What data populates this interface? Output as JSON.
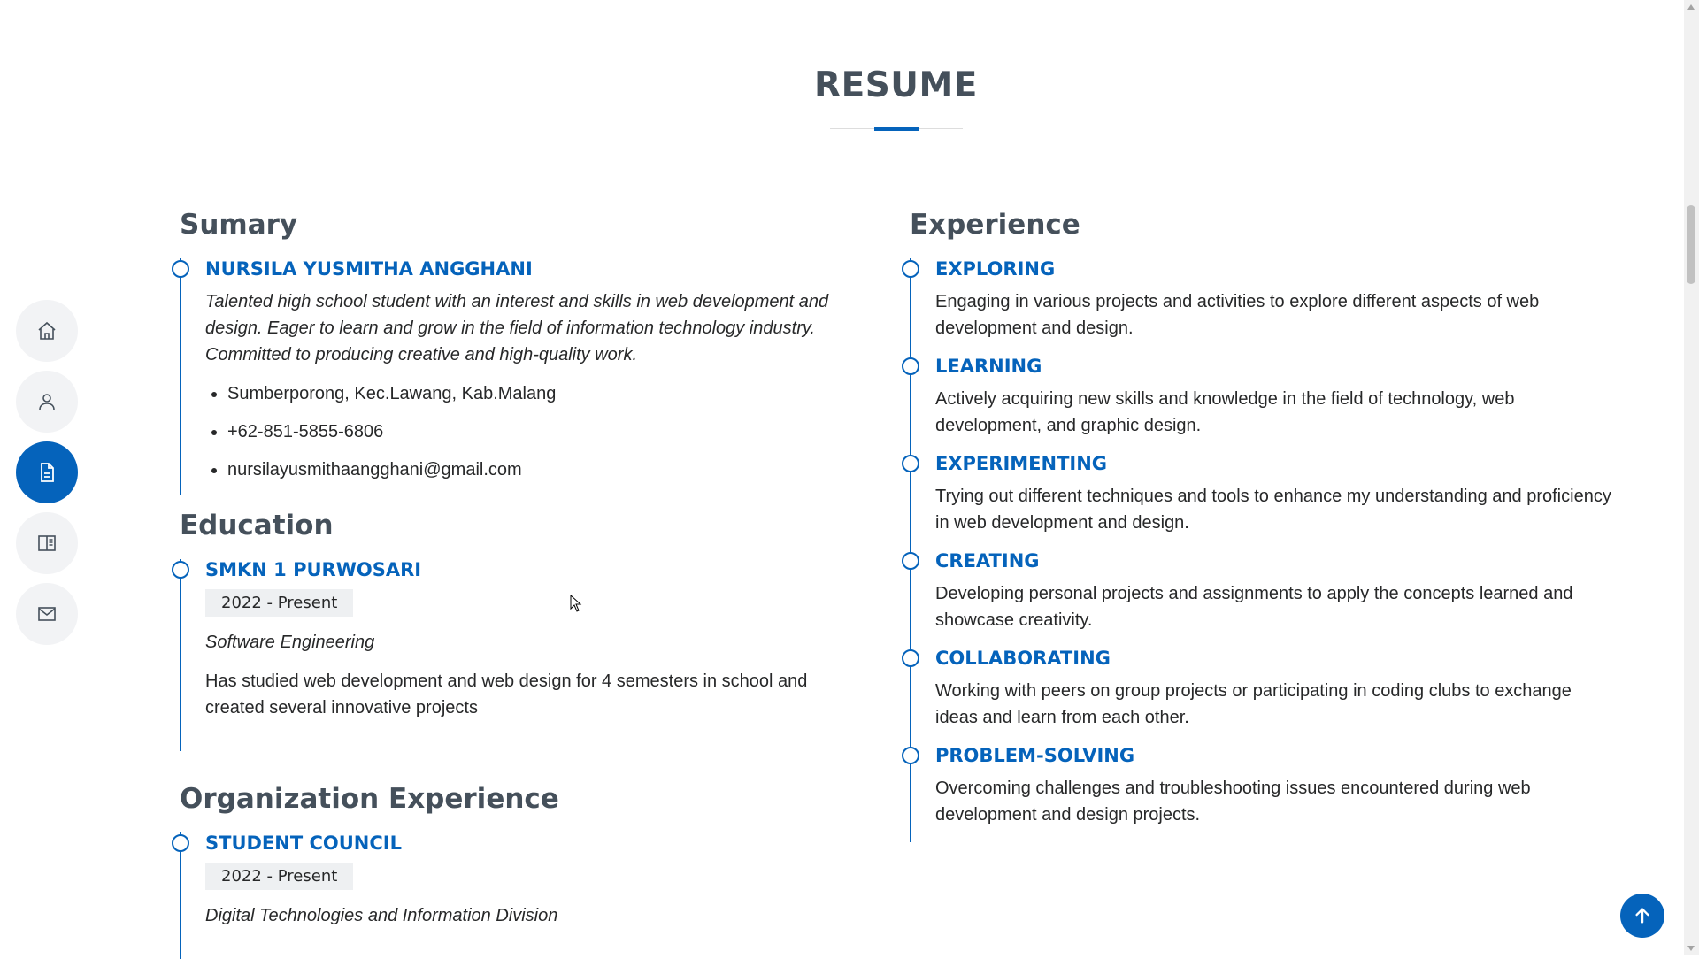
{
  "section_title": "RESUME",
  "nav": {
    "items": [
      {
        "name": "home",
        "icon": "home-icon"
      },
      {
        "name": "about",
        "icon": "person-icon"
      },
      {
        "name": "resume",
        "icon": "file-icon",
        "active": true
      },
      {
        "name": "portfolio",
        "icon": "book-icon"
      },
      {
        "name": "contact",
        "icon": "envelope-icon"
      }
    ]
  },
  "summary": {
    "title": "Sumary",
    "name": "NURSILA YUSMITHA ANGGHANI",
    "description": "Talented high school student with an interest and skills in web development and design. Eager to learn and grow in the field of information technology industry. Committed to producing creative and high-quality work.",
    "contacts": [
      "Sumberporong, Kec.Lawang, Kab.Malang",
      "+62-851-5855-6806",
      "nursilayusmithaangghani@gmail.com"
    ]
  },
  "education": {
    "title": "Education",
    "school": "SMKN 1 PURWOSARI",
    "period": "2022 - Present",
    "major": "Software Engineering",
    "description": "Has studied web development and web design for 4 semesters in school and created several innovative projects"
  },
  "organization": {
    "title": "Organization Experience",
    "name": "STUDENT COUNCIL",
    "period": "2022 - Present",
    "division": "Digital Technologies and Information Division"
  },
  "experience": {
    "title": "Experience",
    "items": [
      {
        "title": "EXPLORING",
        "text": "Engaging in various projects and activities to explore different aspects of web development and design."
      },
      {
        "title": "LEARNING",
        "text": "Actively acquiring new skills and knowledge in the field of technology, web development, and graphic design."
      },
      {
        "title": "EXPERIMENTING",
        "text": "Trying out different techniques and tools to enhance my understanding and proficiency in web development and design."
      },
      {
        "title": "CREATING",
        "text": "Developing personal projects and assignments to apply the concepts learned and showcase creativity."
      },
      {
        "title": "COLLABORATING",
        "text": "Working with peers on group projects or participating in coding clubs to exchange ideas and learn from each other."
      },
      {
        "title": "PROBLEM-SOLVING",
        "text": "Overcoming challenges and troubleshooting issues encountered during web development and design projects."
      }
    ]
  },
  "colors": {
    "accent": "#0563bb",
    "heading": "#45505b",
    "nav_bg": "#f2f3f5"
  }
}
